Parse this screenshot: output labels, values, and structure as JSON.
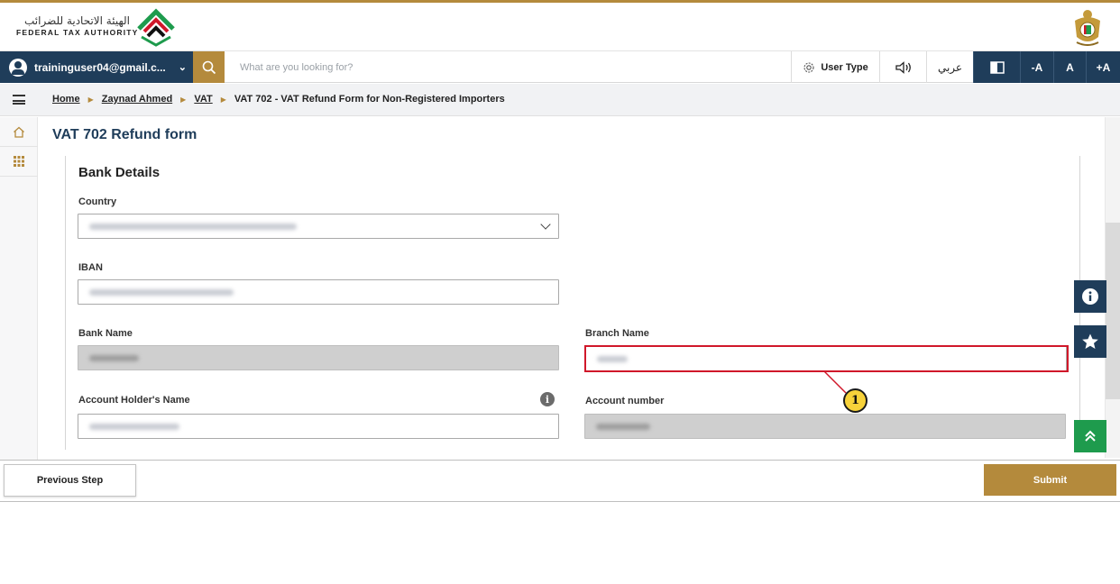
{
  "header": {
    "logo_arabic": "الهيئة الاتحادية للضرائب",
    "logo_english": "FEDERAL TAX AUTHORITY",
    "emblem_icon": "uae-emblem-icon"
  },
  "toolbar": {
    "user_email": "traininguser04@gmail.c...",
    "search_placeholder": "What are you looking for?",
    "user_type_label": "User Type",
    "arabic_label": "عربي",
    "font_decrease": "-A",
    "font_reset": "A",
    "font_increase": "+A"
  },
  "breadcrumb": {
    "items": [
      "Home",
      "Zaynad Ahmed",
      "VAT"
    ],
    "current": "VAT 702 - VAT Refund Form for Non-Registered Importers"
  },
  "form": {
    "title": "VAT 702 Refund form",
    "section_title": "Bank Details",
    "fields": {
      "country": "Country",
      "iban": "IBAN",
      "bank_name": "Bank Name",
      "branch_name": "Branch Name",
      "account_holder": "Account Holder's Name",
      "account_number": "Account number"
    }
  },
  "annotation": {
    "badge": "1"
  },
  "buttons": {
    "previous": "Previous Step",
    "submit": "Submit"
  },
  "colors": {
    "navy": "#1f3d5a",
    "gold": "#b48a3c",
    "highlight_red": "#d0182a",
    "green": "#1e9b4d"
  }
}
